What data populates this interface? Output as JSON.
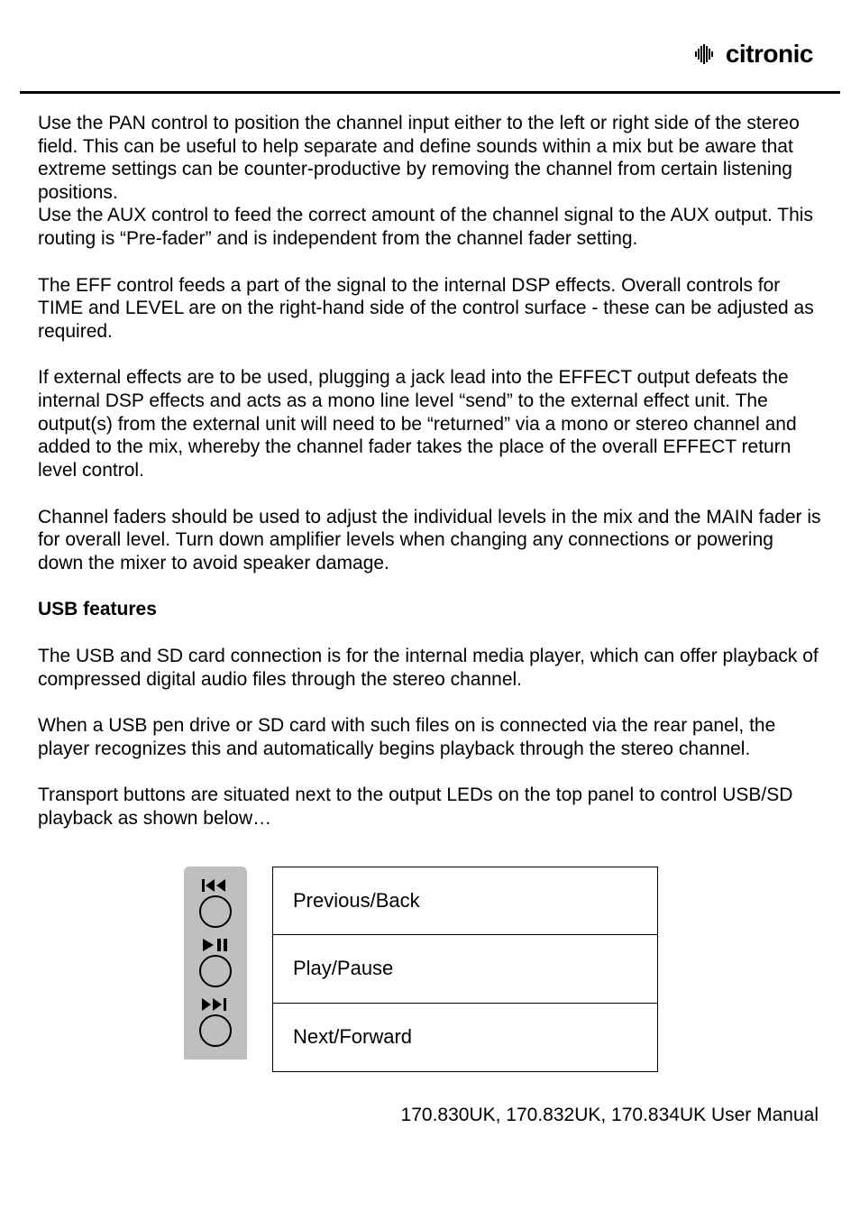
{
  "brand": {
    "name": "citronic"
  },
  "paragraphs": {
    "p1": "Use the PAN control to position the channel input either to the left or right side of the stereo field. This can be useful to help separate and define sounds within a mix but be aware that extreme settings can be counter-productive by removing the channel from certain listening positions.",
    "p2": "Use the AUX control to feed the correct amount of the channel signal to the AUX output. This routing is “Pre-fader” and is independent from the channel fader setting.",
    "p3": "The EFF control feeds a part of the signal to the internal DSP effects. Overall controls for TIME and LEVEL are on the right-hand side of the control surface - these can be adjusted as required.",
    "p4": "If external effects are to be used, plugging a jack lead into the EFFECT output defeats the internal DSP effects and acts as a mono line level “send” to the external effect unit. The output(s) from the external unit will need to be “returned” via a mono or stereo channel and added to the mix, whereby the channel fader takes the place of the overall EFFECT return level control.",
    "p5": "Channel faders should be used to adjust the individual levels in the mix and the MAIN fader is for overall level. Turn down amplifier levels when changing any connections or powering down the mixer to avoid speaker damage."
  },
  "section_heading": "USB features",
  "usb_paragraphs": {
    "u1": "The USB and SD card connection is for the internal media player, which can offer playback of compressed digital audio files through the stereo channel.",
    "u2": "When a USB pen drive or SD card with such files on is connected via the rear panel, the player recognizes this and automatically begins playback through the stereo channel.",
    "u3": "Transport buttons are situated next to the output LEDs on the top panel to control USB/SD playback as shown below…"
  },
  "transport": {
    "prev": "Previous/Back",
    "play": "Play/Pause",
    "next": "Next/Forward"
  },
  "footer": "170.830UK, 170.832UK, 170.834UK User Manual"
}
